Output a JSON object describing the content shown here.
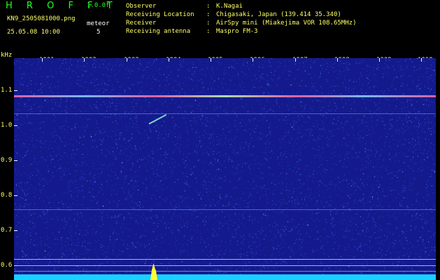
{
  "header": {
    "app_title": "H R O F F T",
    "version": "1.0.0f",
    "filename": "KN9_2505081000.png",
    "meteor_label": "meteor",
    "timestamp": "25.05.08 10:00",
    "meteor_count": "5"
  },
  "station": {
    "rows": [
      {
        "key": "Observer",
        "sep": ":",
        "value": "K.Nagai"
      },
      {
        "key": "Receiving Location",
        "sep": ":",
        "value": "Chigasaki, Japan (139.414 35.340)"
      },
      {
        "key": "Receiver",
        "sep": ":",
        "value": "AirSpy mini (Miakejima VOR 108.65MHz)"
      },
      {
        "key": "Receiving antenna",
        "sep": ":",
        "value": "Maspro FM-3"
      }
    ]
  },
  "spectrogram": {
    "unit": "kHz",
    "time_labels": [
      "1001",
      "1002",
      "1003",
      "1004",
      "1005",
      "1006",
      "1007",
      "1008",
      "1009",
      "1010"
    ],
    "freq_labels": [
      "1.1",
      "1.0",
      "0.9",
      "0.8",
      "0.7",
      "0.6"
    ],
    "colors": {
      "background": "#141a8c",
      "carrier": "#ff6fa8",
      "meteor": "#ffff33",
      "noise_floor": "#19d0ff",
      "label": "#ffff66"
    }
  }
}
